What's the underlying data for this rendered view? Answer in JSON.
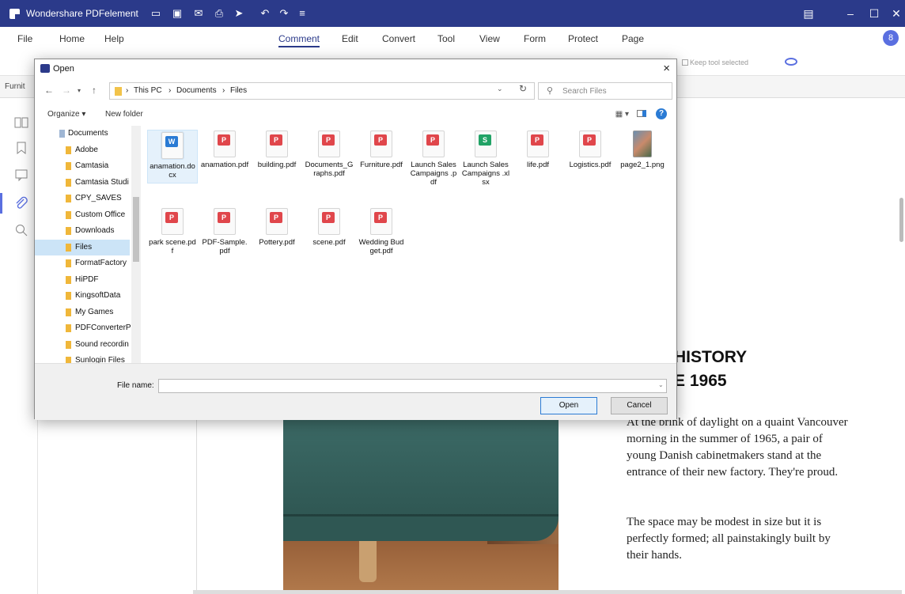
{
  "app": {
    "title": "Wondershare PDFelement",
    "quick_icons": [
      "folder-open-icon",
      "save-icon",
      "mail-icon",
      "print-icon",
      "share-icon",
      "undo-icon",
      "redo-icon",
      "more-icon"
    ],
    "window_controls": [
      "feedback-icon",
      "minimize-icon",
      "maximize-icon",
      "close-icon"
    ],
    "avatar_initial": "8"
  },
  "menu": {
    "left_items": [
      "File",
      "Home",
      "Help"
    ],
    "ribbon_tabs": [
      "Comment",
      "Edit",
      "Convert",
      "Tool",
      "View",
      "Form",
      "Protect",
      "Page"
    ],
    "active_tab": "Comment"
  },
  "toolbar": {
    "keep_tool_label": "Keep tool selected"
  },
  "doc_tab": {
    "label": "Furnit"
  },
  "document": {
    "title_line1": "HISTORY",
    "title_line2": "E 1965",
    "paragraph1": "At the brink of daylight on a quaint Vancouver morning in the summer of 1965, a pair of young Danish cabinetmakers stand at the entrance of their new factory. They're proud.",
    "paragraph2": "The space may be modest in size but it is perfectly formed; all painstakingly built by their hands."
  },
  "dialog": {
    "title": "Open",
    "close_glyph": "×",
    "breadcrumb": [
      "This PC",
      "Documents",
      "Files"
    ],
    "search_placeholder": "Search Files",
    "commands": {
      "organize": "Organize ▾",
      "new_folder": "New folder"
    },
    "nav_items": [
      {
        "label": "Documents",
        "root": true
      },
      {
        "label": "Adobe"
      },
      {
        "label": "Camtasia"
      },
      {
        "label": "Camtasia Studi"
      },
      {
        "label": "CPY_SAVES"
      },
      {
        "label": "Custom Office"
      },
      {
        "label": "Downloads"
      },
      {
        "label": "Files",
        "selected": true
      },
      {
        "label": "FormatFactory"
      },
      {
        "label": "HiPDF"
      },
      {
        "label": "KingsoftData"
      },
      {
        "label": "My Games"
      },
      {
        "label": "PDFConverterP"
      },
      {
        "label": "Sound recordin"
      },
      {
        "label": "Sunlogin Files"
      }
    ],
    "files": [
      {
        "name": "anamation.docx",
        "type": "word"
      },
      {
        "name": "anamation.pdf",
        "type": "pdf"
      },
      {
        "name": "building.pdf",
        "type": "pdf"
      },
      {
        "name": "Documents_Graphs.pdf",
        "type": "pdf"
      },
      {
        "name": "Furniture.pdf",
        "type": "pdf"
      },
      {
        "name": "Launch Sales Campaigns .pdf",
        "type": "pdf"
      },
      {
        "name": "Launch Sales Campaigns .xlsx",
        "type": "excel"
      },
      {
        "name": "life.pdf",
        "type": "pdf"
      },
      {
        "name": "Logistics.pdf",
        "type": "pdf"
      },
      {
        "name": "page2_1.png",
        "type": "image"
      },
      {
        "name": "park scene.pdf",
        "type": "pdf"
      },
      {
        "name": "PDF-Sample.pdf",
        "type": "pdf"
      },
      {
        "name": "Pottery.pdf",
        "type": "pdf"
      },
      {
        "name": "scene.pdf",
        "type": "pdf"
      },
      {
        "name": "Wedding Budget.pdf",
        "type": "pdf"
      }
    ],
    "file_name_label": "File name:",
    "file_name_value": "",
    "open_button": "Open",
    "cancel_button": "Cancel"
  },
  "colors": {
    "titlebar": "#2b3a8a",
    "accent": "#5a6fe0",
    "pdf_badge": "#e0464b",
    "word_badge": "#2b7bd4",
    "excel_badge": "#21a366"
  }
}
